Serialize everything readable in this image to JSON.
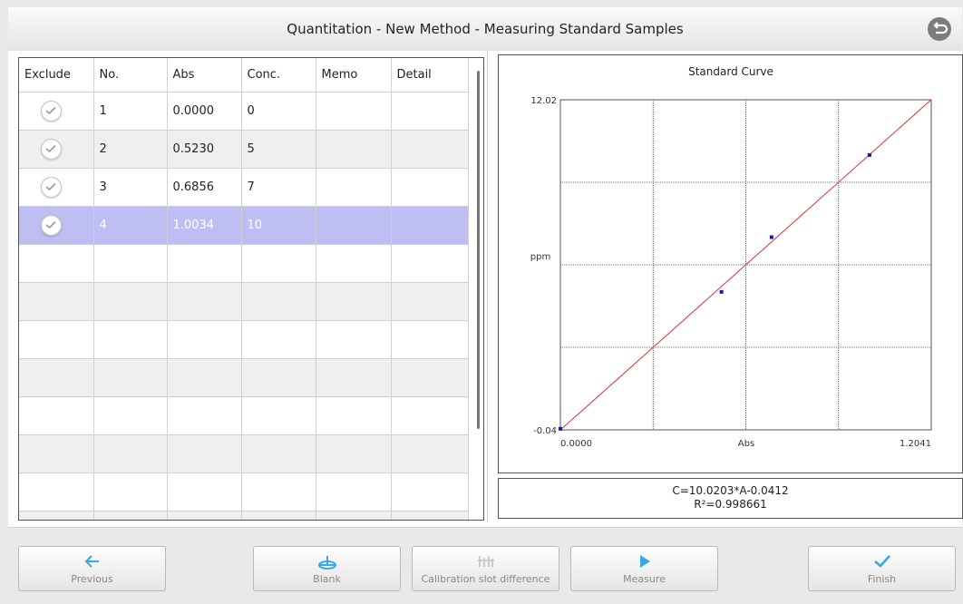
{
  "window": {
    "title": "Quantitation - New Method - Measuring Standard Samples"
  },
  "table": {
    "headers": {
      "exclude": "Exclude",
      "no": "No.",
      "abs": "Abs",
      "conc": "Conc.",
      "memo": "Memo",
      "detail": "Detail"
    },
    "rows": [
      {
        "no": "1",
        "abs": "0.0000",
        "conc": "0",
        "memo": "",
        "detail": ""
      },
      {
        "no": "2",
        "abs": "0.5230",
        "conc": "5",
        "memo": "",
        "detail": ""
      },
      {
        "no": "3",
        "abs": "0.6856",
        "conc": "7",
        "memo": "",
        "detail": ""
      },
      {
        "no": "4",
        "abs": "1.0034",
        "conc": "10",
        "memo": "",
        "detail": ""
      }
    ],
    "selected_row": "4"
  },
  "chart_data": {
    "type": "scatter",
    "title": "Standard Curve",
    "xlabel": "Abs",
    "ylabel": "ppm",
    "xlim": [
      0.0,
      1.2041
    ],
    "ylim": [
      -0.04,
      12.02
    ],
    "x_tick_labels": [
      "0.0000",
      "1.2041"
    ],
    "y_tick_labels": [
      "12.02",
      "-0.04"
    ],
    "grid": true,
    "points": [
      {
        "x": 0.0,
        "y": 0
      },
      {
        "x": 0.523,
        "y": 5
      },
      {
        "x": 0.6856,
        "y": 7
      },
      {
        "x": 1.0034,
        "y": 10
      }
    ],
    "fit_line": {
      "slope": 10.0203,
      "intercept": -0.0412
    },
    "colors": {
      "line": "#e03030",
      "points": "#1a1aa8"
    }
  },
  "equation": {
    "line1": "C=10.0203*A-0.0412",
    "line2": "R²=0.998661"
  },
  "buttons": {
    "previous": "Previous",
    "blank": "Blank",
    "calibration": "Calibration slot difference",
    "measure": "Measure",
    "finish": "Finish"
  },
  "colors": {
    "accent": "#3aa7e6",
    "selected_row": "#bebef3"
  }
}
